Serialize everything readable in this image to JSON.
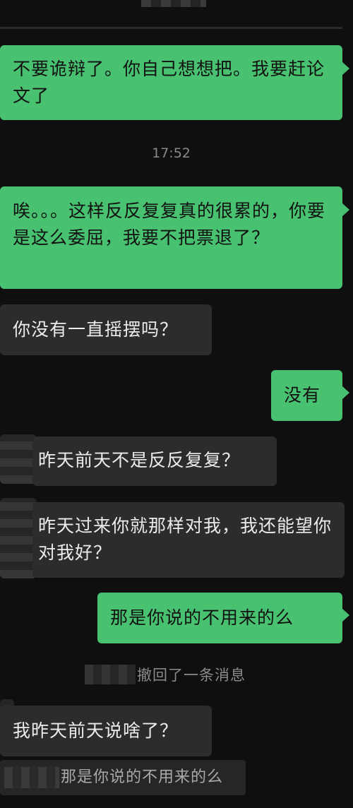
{
  "chat": {
    "timestamp": "17:52",
    "recall_notice": "撤回了一条消息",
    "messages": [
      {
        "side": "out",
        "text": "不要诡辩了。你自己想想把。我要赶论文了"
      },
      {
        "side": "out",
        "text": "唉。。。这样反反复复真的很累的，你要是这么委屈，我要不把票退了？"
      },
      {
        "side": "in",
        "text": "你没有一直摇摆吗？"
      },
      {
        "side": "out",
        "text": "没有"
      },
      {
        "side": "in",
        "text": "昨天前天不是反反复复？"
      },
      {
        "side": "in",
        "text": "昨天过来你就那样对我，我还能望你对我好？"
      },
      {
        "side": "out",
        "text": "那是你说的不用来的么"
      },
      {
        "side": "in",
        "text": "我昨天前天说啥了？"
      }
    ],
    "quote": {
      "text": "那是你说的不用来的么"
    }
  },
  "colors": {
    "background": "#0f0f0f",
    "outgoing_bubble": "#48c270",
    "incoming_bubble": "#2c2c2c",
    "meta_text": "#8a8a8a"
  }
}
